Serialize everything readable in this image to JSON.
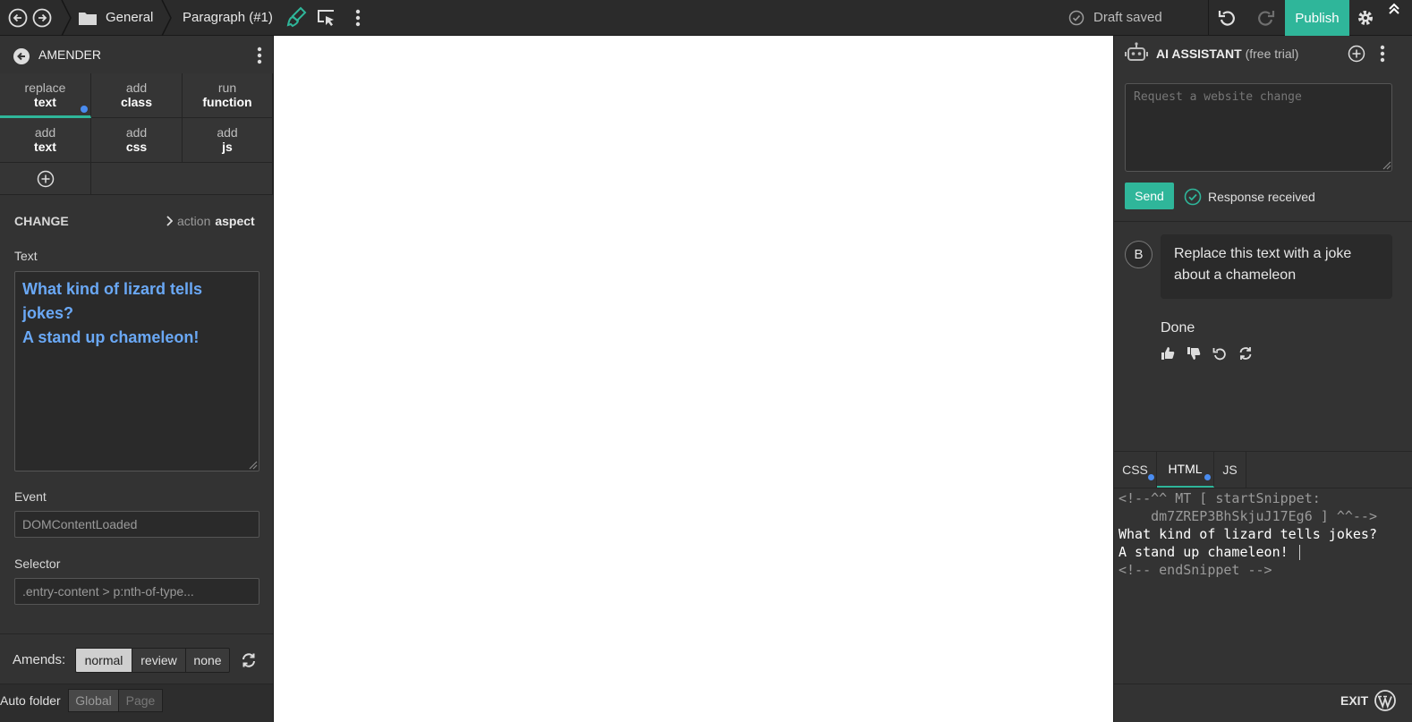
{
  "topbar": {
    "folder_label": "General",
    "element_label": "Paragraph (#1)",
    "draft_status": "Draft saved",
    "publish_label": "Publish",
    "colors": {
      "accent": "#2fb69a",
      "bar": "#2b2b2b"
    }
  },
  "amender": {
    "title": "AMENDER",
    "actions": [
      {
        "line1": "replace",
        "line2": "text"
      },
      {
        "line1": "add",
        "line2": "class"
      },
      {
        "line1": "run",
        "line2": "function"
      },
      {
        "line1": "add",
        "line2": "text"
      },
      {
        "line1": "add",
        "line2": "css"
      },
      {
        "line1": "add",
        "line2": "js"
      }
    ],
    "change_heading": "CHANGE",
    "change_nav": {
      "action": "action",
      "aspect": "aspect"
    },
    "text_label": "Text",
    "text_value": "What kind of lizard tells jokes?\nA stand up chameleon!",
    "event_label": "Event",
    "event_value": "DOMContentLoaded",
    "selector_label": "Selector",
    "selector_value": ".entry-content > p:nth-of-type...",
    "amends_label": "Amends:",
    "amends_options": [
      "normal",
      "review",
      "none"
    ],
    "amends_selected": "normal",
    "autofolder_label": "Auto folder",
    "autofolder_options": [
      "Global",
      "Page"
    ]
  },
  "assistant": {
    "title": "AI ASSISTANT",
    "trial": "(free trial)",
    "request_placeholder": "Request a website change",
    "send_label": "Send",
    "response_status": "Response received",
    "user_avatar": "B",
    "user_message": "Replace this text with a joke about a chameleon",
    "assistant_reply": "Done"
  },
  "code_panel": {
    "tabs": [
      "CSS",
      "HTML",
      "JS"
    ],
    "active_tab": "HTML",
    "line1": "<!--^^ MT [ startSnippet:",
    "line2": "    dm7ZREP3BhSkjuJ17Eg6 ] ^^-->",
    "line3": "What kind of lizard tells jokes?",
    "line4": "A stand up chameleon!",
    "line5": "<!-- endSnippet -->"
  },
  "footer": {
    "exit_label": "EXIT"
  }
}
